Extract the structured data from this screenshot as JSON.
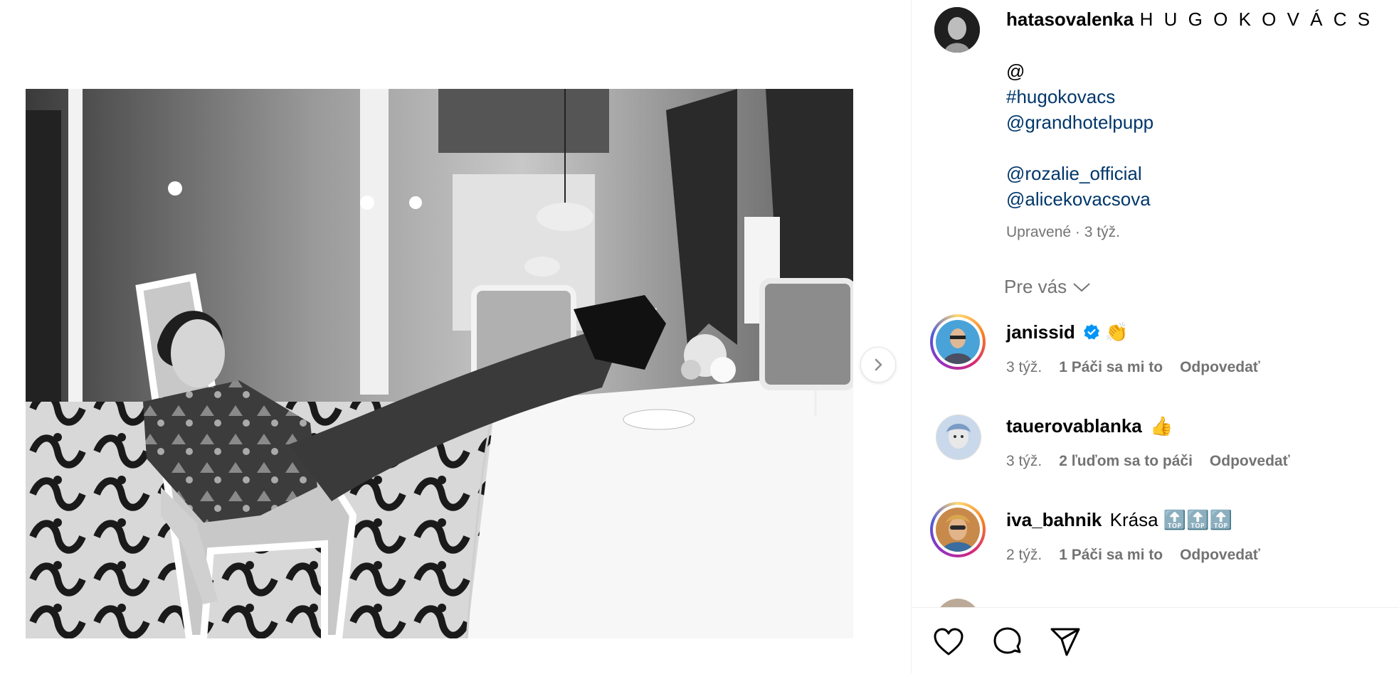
{
  "post": {
    "author": "hatasovalenka",
    "caption_title": "H U G O K O V Á C S",
    "caption_lines": [
      "@",
      "#hugokovacs",
      "@grandhotelpupp",
      "",
      "@rozalie_official",
      "@alicekovacsova"
    ],
    "edited_label": "Upravené · 3 týž."
  },
  "for_you_label": "Pre vás",
  "comments": [
    {
      "user": "janissid",
      "text": "👏",
      "time": "3 týž.",
      "likes": "1 Páči sa mi to",
      "reply": "Odpovedať",
      "verified": true
    },
    {
      "user": "tauerovablanka",
      "text": "👍",
      "time": "3 týž.",
      "likes": "2 ľuďom sa to páči",
      "reply": "Odpovedať",
      "verified": false
    },
    {
      "user": "iva_bahnik",
      "text": "Krása 🔝🔝🔝",
      "time": "2 týž.",
      "likes": "1 Páči sa mi to",
      "reply": "Odpovedať",
      "verified": false
    }
  ],
  "icons": {
    "next": "chevron-right-icon",
    "like": "heart-icon",
    "comment": "comment-bubble-icon",
    "share": "paper-plane-icon",
    "verified": "verified-badge-icon"
  },
  "colors": {
    "link": "#00376b",
    "muted": "#737373",
    "verified": "#0095f6"
  }
}
